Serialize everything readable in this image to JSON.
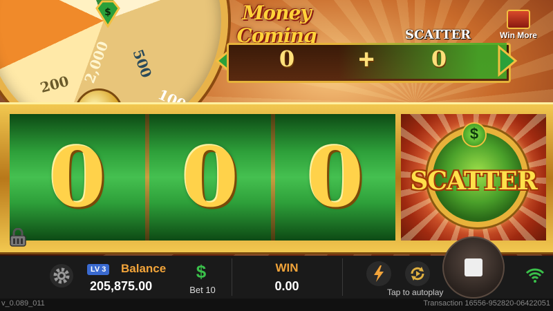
{
  "title": "Money Coming",
  "wheel": {
    "labels": [
      "2,000",
      "500",
      "200",
      "100"
    ]
  },
  "top_panel": {
    "left_value": "0",
    "operator": "+",
    "right_value": "0",
    "scatter_label": "SCATTER"
  },
  "win_more": "Win More",
  "reels": [
    "0",
    "0",
    "0"
  ],
  "scatter_reel": {
    "label": "SCATTER",
    "coin_symbol": "$"
  },
  "bottom": {
    "level": "LV 3",
    "balance_label": "Balance",
    "balance_value": "205,875.00",
    "bet_symbol": "$",
    "bet_label": "Bet 10",
    "win_label": "WIN",
    "win_value": "0.00",
    "autoplay_hint": "Tap to autoplay"
  },
  "footer": {
    "version": "v_0.089_011",
    "transaction": "Transaction 16556-952820-06422051"
  },
  "colors": {
    "reel_green": "#2ea03a",
    "gold": "#ffd24a",
    "accent_orange": "#f2a43a",
    "bar_bg": "#1a1a1a"
  }
}
